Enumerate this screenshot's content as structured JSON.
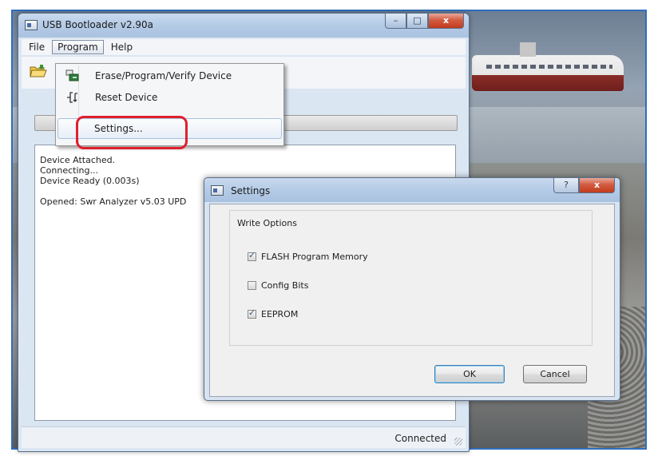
{
  "main_window": {
    "title": "USB Bootloader v2.90a",
    "caption": {
      "minimize": "–",
      "maximize": "□",
      "close": "x"
    },
    "menu": [
      "File",
      "Program",
      "Help"
    ],
    "program_menu": {
      "items": [
        {
          "label": "Erase/Program/Verify Device",
          "icon": "program-device-icon"
        },
        {
          "label": "Reset Device",
          "icon": "reset-device-icon"
        },
        {
          "label": "Settings...",
          "icon": ""
        }
      ]
    },
    "log_lines": [
      "Device Attached.",
      "Connecting...",
      "Device Ready (0.003s)",
      "",
      "Opened: Swr Analyzer v5.03 UPD"
    ],
    "status": "Connected"
  },
  "settings_dialog": {
    "title": "Settings",
    "caption": {
      "help": "?",
      "close": "x"
    },
    "group_title": "Write Options",
    "options": [
      {
        "label": "FLASH Program Memory",
        "checked": true
      },
      {
        "label": "Config Bits",
        "checked": false
      },
      {
        "label": "EEPROM",
        "checked": true
      }
    ],
    "ok_label": "OK",
    "cancel_label": "Cancel"
  },
  "colors": {
    "highlight_ring": "#e01f2e",
    "frame_border": "#2f6dbf",
    "close_button": "#c23b1c"
  }
}
